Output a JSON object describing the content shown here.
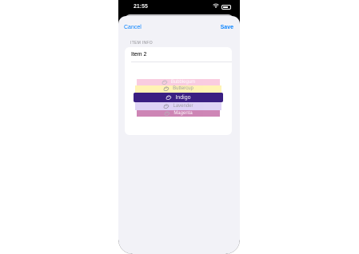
{
  "status_bar": {
    "time": "21:55"
  },
  "nav": {
    "cancel": "Cancel",
    "save": "Save"
  },
  "section": {
    "header": "ITEM INFO"
  },
  "item": {
    "name_value": "Item 2"
  },
  "picker": {
    "options": [
      {
        "label": "Bubblegum",
        "color": "#f5a3c7",
        "icon": "paintpalette-icon"
      },
      {
        "label": "Buttercup",
        "color": "#fff2a8",
        "icon": "paintpalette-icon"
      },
      {
        "label": "Indigo",
        "color": "#3a1f82",
        "icon": "paintpalette-icon",
        "selected": true
      },
      {
        "label": "Lavender",
        "color": "#d9ccf5",
        "icon": "paintpalette-icon"
      },
      {
        "label": "Magenta",
        "color": "#a5237a",
        "icon": "paintpalette-icon"
      }
    ]
  }
}
